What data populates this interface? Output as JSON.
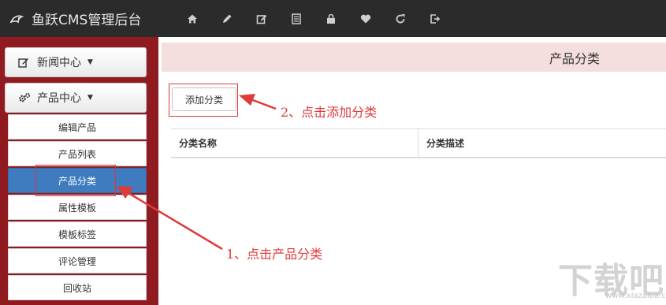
{
  "app": {
    "title": "鱼跃CMS管理后台"
  },
  "topnav": {
    "icons": [
      "home-icon",
      "pencil-icon",
      "edit-square-icon",
      "list-icon",
      "lock-icon",
      "heart-icon",
      "refresh-icon",
      "logout-icon"
    ]
  },
  "sidebar": {
    "news_label": "新闻中心",
    "product_label": "产品中心",
    "items": [
      {
        "label": "编辑产品"
      },
      {
        "label": "产品列表"
      },
      {
        "label": "产品分类",
        "active": true
      },
      {
        "label": "属性模板"
      },
      {
        "label": "模板标签"
      },
      {
        "label": "评论管理"
      },
      {
        "label": "回收站"
      }
    ]
  },
  "main": {
    "page_title": "产品分类",
    "add_button_label": "添加分类",
    "table": {
      "columns": [
        "分类名称",
        "分类描述"
      ]
    }
  },
  "annotations": {
    "step1": "1、点击产品分类",
    "step2": "2、点击添加分类"
  },
  "watermark": {
    "main": "下载吧",
    "sub": "www.xiazaiba.com"
  },
  "colors": {
    "topbar": "#2b2b2b",
    "sidebar": "#8f1b21",
    "active_item": "#3e7bbf",
    "header_band": "#f4dede",
    "annotation": "#e03a3a"
  }
}
